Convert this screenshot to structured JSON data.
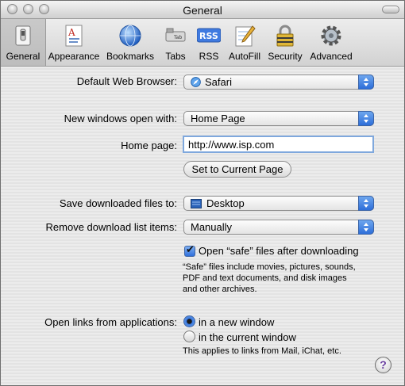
{
  "window": {
    "title": "General"
  },
  "toolbar": {
    "items": [
      {
        "label": "General",
        "icon": "switch-icon",
        "selected": true
      },
      {
        "label": "Appearance",
        "icon": "appearance-icon"
      },
      {
        "label": "Bookmarks",
        "icon": "globe-icon"
      },
      {
        "label": "Tabs",
        "icon": "tabs-icon"
      },
      {
        "label": "RSS",
        "icon": "rss-icon",
        "badge": "RSS"
      },
      {
        "label": "AutoFill",
        "icon": "pencil-icon"
      },
      {
        "label": "Security",
        "icon": "lock-icon"
      },
      {
        "label": "Advanced",
        "icon": "gear-icon"
      }
    ]
  },
  "general": {
    "default_browser_label": "Default Web Browser:",
    "default_browser_value": "Safari",
    "new_windows_label": "New windows open with:",
    "new_windows_value": "Home Page",
    "home_page_label": "Home page:",
    "home_page_value": "http://www.isp.com",
    "set_current_button": "Set to Current Page",
    "save_downloads_label": "Save downloaded files to:",
    "save_downloads_value": "Desktop",
    "remove_items_label": "Remove download list items:",
    "remove_items_value": "Manually",
    "open_safe_label": "Open “safe” files after downloading",
    "open_safe_checked": true,
    "safe_note": [
      "“Safe” files include movies, pictures, sounds,",
      "PDF and text documents, and disk images",
      "and other archives."
    ],
    "open_links_label": "Open links from applications:",
    "radio_new_window": "in a new window",
    "radio_current_window": "in the current window",
    "radio_selected": "new_window",
    "links_note": "This applies to links from Mail, iChat, etc.",
    "help_label": "?"
  },
  "colors": {
    "accent": "#2d6ed9",
    "window_bg": "#e6e6e6"
  }
}
